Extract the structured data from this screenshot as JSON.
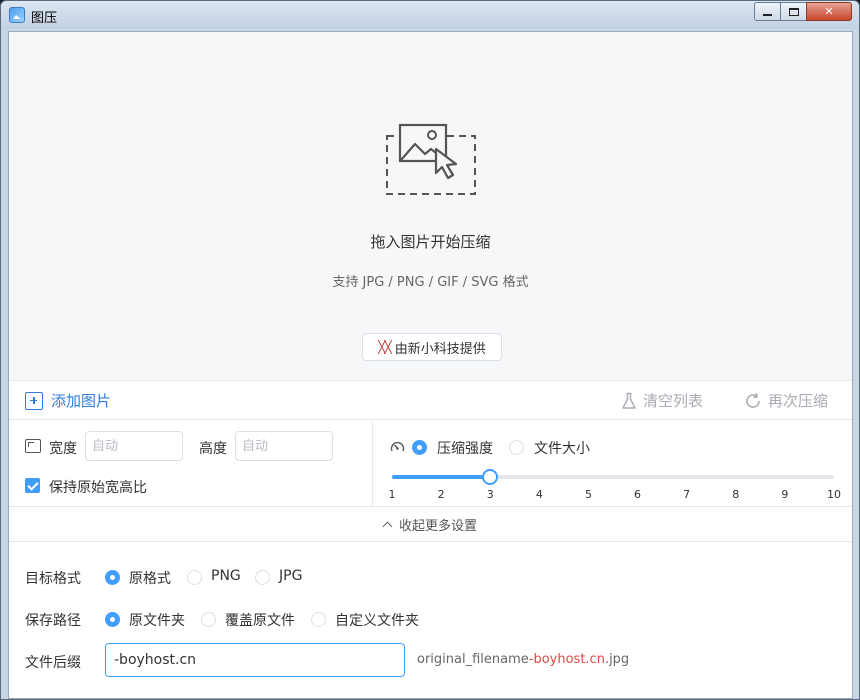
{
  "window": {
    "title": "图压"
  },
  "dropzone": {
    "title": "拖入图片开始压缩",
    "subtitle": "支持 JPG / PNG / GIF / SVG 格式",
    "credit_label": "由新小科技提供"
  },
  "toolbar": {
    "add_label": "添加图片",
    "clear_label": "清空列表",
    "recompress_label": "再次压缩"
  },
  "resize": {
    "width_label": "宽度",
    "width_placeholder": "自动",
    "height_label": "高度",
    "height_placeholder": "自动",
    "keep_ratio_label": "保持原始宽高比",
    "keep_ratio_checked": true
  },
  "compression": {
    "mode_strength_label": "压缩强度",
    "mode_size_label": "文件大小",
    "selected_mode": "压缩强度",
    "slider_min": 1,
    "slider_max": 10,
    "slider_value": 3,
    "ticks": [
      "1",
      "2",
      "3",
      "4",
      "5",
      "6",
      "7",
      "8",
      "9",
      "10"
    ]
  },
  "collapse_label": "收起更多设置",
  "advanced": {
    "format_label": "目标格式",
    "format_options": [
      "原格式",
      "PNG",
      "JPG"
    ],
    "format_selected": "原格式",
    "path_label": "保存路径",
    "path_options": [
      "原文件夹",
      "覆盖原文件",
      "自定义文件夹"
    ],
    "path_selected": "原文件夹",
    "suffix_label": "文件后缀",
    "suffix_value": "-boyhost.cn",
    "preview_prefix": "original_filename",
    "preview_suffix": "-boyhost.cn",
    "preview_ext": ".jpg"
  },
  "colors": {
    "accent": "#409eff",
    "link": "#2f7de1",
    "suffix_highlight": "#e0483e"
  }
}
